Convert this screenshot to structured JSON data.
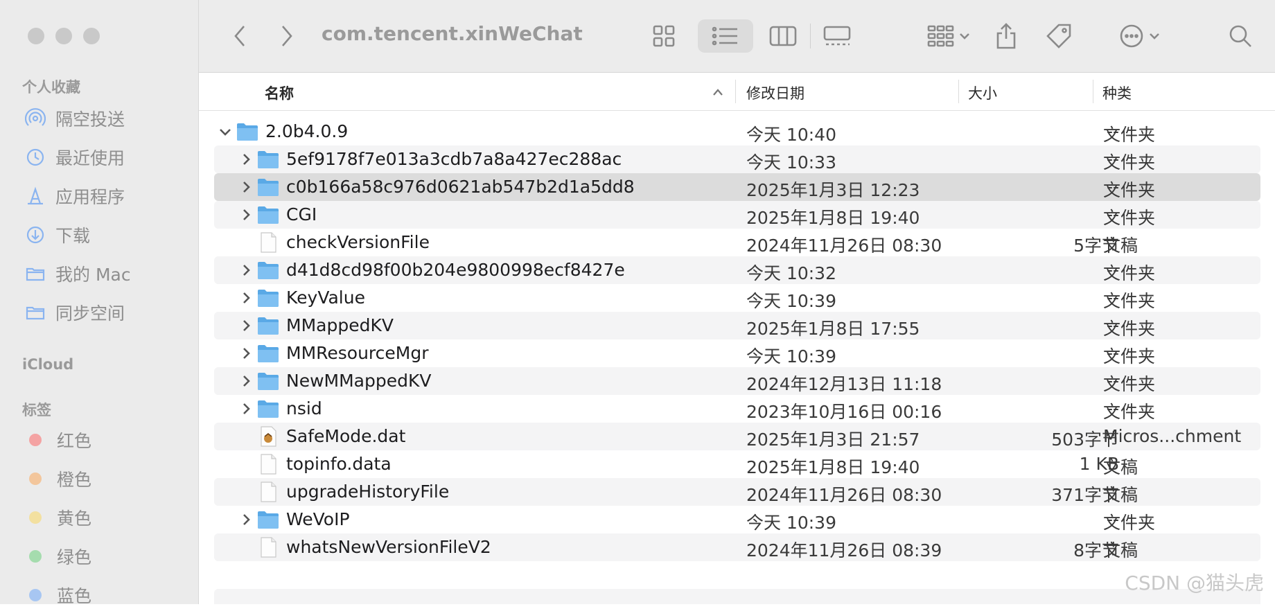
{
  "window": {
    "path_title": "com.tencent.xinWeChat"
  },
  "sidebar": {
    "favorites_title": "个人收藏",
    "favorites": [
      {
        "label": "隔空投送",
        "icon": "airdrop-icon"
      },
      {
        "label": "最近使用",
        "icon": "clock-icon"
      },
      {
        "label": "应用程序",
        "icon": "applications-icon"
      },
      {
        "label": "下载",
        "icon": "download-icon"
      },
      {
        "label": "我的 Mac",
        "icon": "folder-icon"
      },
      {
        "label": "同步空间",
        "icon": "folder-icon"
      }
    ],
    "icloud_title": "iCloud",
    "tags_title": "标签",
    "tags": [
      {
        "label": "红色",
        "color": "#f4a3a3"
      },
      {
        "label": "橙色",
        "color": "#f3c69c"
      },
      {
        "label": "黄色",
        "color": "#f3e0a0"
      },
      {
        "label": "绿色",
        "color": "#a5dcae"
      },
      {
        "label": "蓝色",
        "color": "#a7c6f2"
      }
    ]
  },
  "columns": {
    "name": "名称",
    "date": "修改日期",
    "size": "大小",
    "kind": "种类"
  },
  "rows": [
    {
      "name": "2.0b4.0.9",
      "date": "今天 10:40",
      "size": "--",
      "kind": "文件夹",
      "type": "folder",
      "level": 0,
      "chevron": "down"
    },
    {
      "name": "5ef9178f7e013a3cdb7a8a427ec288ac",
      "date": "今天 10:33",
      "size": "--",
      "kind": "文件夹",
      "type": "folder",
      "level": 1,
      "chevron": "right"
    },
    {
      "name": "c0b166a58c976d0621ab547b2d1a5dd8",
      "date": "2025年1月3日 12:23",
      "size": "--",
      "kind": "文件夹",
      "type": "folder",
      "level": 1,
      "chevron": "right",
      "selected": true
    },
    {
      "name": "CGI",
      "date": "2025年1月8日 19:40",
      "size": "--",
      "kind": "文件夹",
      "type": "folder",
      "level": 1,
      "chevron": "right"
    },
    {
      "name": "checkVersionFile",
      "date": "2024年11月26日 08:30",
      "size": "5字节",
      "kind": "文稿",
      "type": "file",
      "level": 1,
      "chevron": ""
    },
    {
      "name": "d41d8cd98f00b204e9800998ecf8427e",
      "date": "今天 10:32",
      "size": "--",
      "kind": "文件夹",
      "type": "folder",
      "level": 1,
      "chevron": "right"
    },
    {
      "name": "KeyValue",
      "date": "今天 10:39",
      "size": "--",
      "kind": "文件夹",
      "type": "folder",
      "level": 1,
      "chevron": "right"
    },
    {
      "name": "MMappedKV",
      "date": "2025年1月8日 17:55",
      "size": "--",
      "kind": "文件夹",
      "type": "folder",
      "level": 1,
      "chevron": "right"
    },
    {
      "name": "MMResourceMgr",
      "date": "今天 10:39",
      "size": "--",
      "kind": "文件夹",
      "type": "folder",
      "level": 1,
      "chevron": "right"
    },
    {
      "name": "NewMMappedKV",
      "date": "2024年12月13日 11:18",
      "size": "--",
      "kind": "文件夹",
      "type": "folder",
      "level": 1,
      "chevron": "right"
    },
    {
      "name": "nsid",
      "date": "2023年10月16日 00:16",
      "size": "--",
      "kind": "文件夹",
      "type": "folder",
      "level": 1,
      "chevron": "right"
    },
    {
      "name": "SafeMode.dat",
      "date": "2025年1月3日 21:57",
      "size": "503字节",
      "kind": "Micros...chment",
      "type": "dat",
      "level": 1,
      "chevron": ""
    },
    {
      "name": "topinfo.data",
      "date": "2025年1月8日 19:40",
      "size": "1 KB",
      "kind": "文稿",
      "type": "file",
      "level": 1,
      "chevron": ""
    },
    {
      "name": "upgradeHistoryFile",
      "date": "2024年11月26日 08:30",
      "size": "371字节",
      "kind": "文稿",
      "type": "file",
      "level": 1,
      "chevron": ""
    },
    {
      "name": "WeVoIP",
      "date": "今天 10:39",
      "size": "--",
      "kind": "文件夹",
      "type": "folder",
      "level": 1,
      "chevron": "right"
    },
    {
      "name": "whatsNewVersionFileV2",
      "date": "2024年11月26日 08:39",
      "size": "8字节",
      "kind": "文稿",
      "type": "file",
      "level": 1,
      "chevron": ""
    }
  ],
  "watermark": "CSDN @猫头虎"
}
